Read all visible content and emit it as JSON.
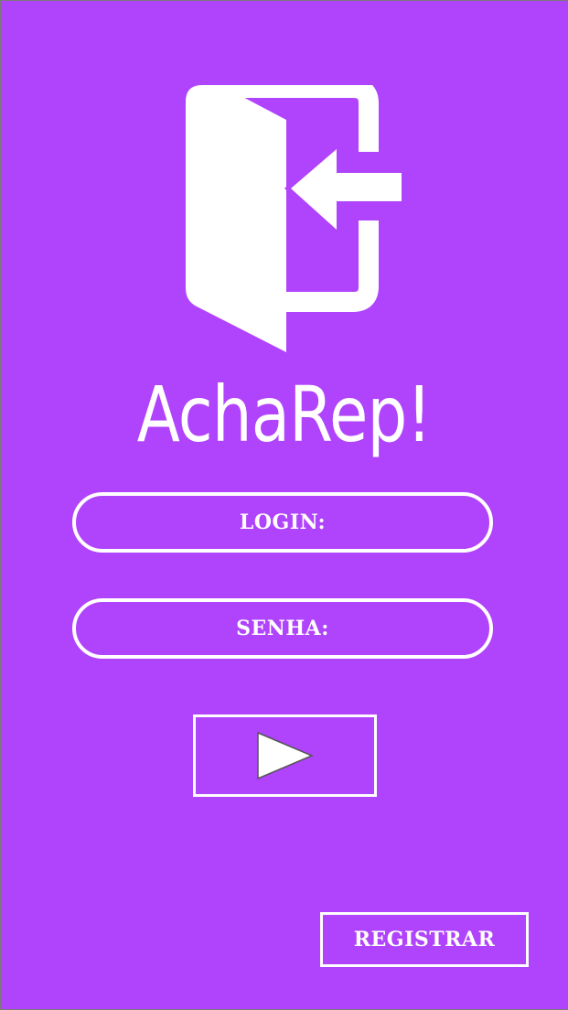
{
  "app": {
    "title": "AchaRep!",
    "logo_icon": "door-enter-icon"
  },
  "form": {
    "login_label": "LOGIN:",
    "password_label": "SENHA:",
    "submit_icon": "play-arrow-icon"
  },
  "actions": {
    "register_label": "REGISTRAR"
  },
  "colors": {
    "background": "#b043fc",
    "foreground": "#ffffff"
  }
}
